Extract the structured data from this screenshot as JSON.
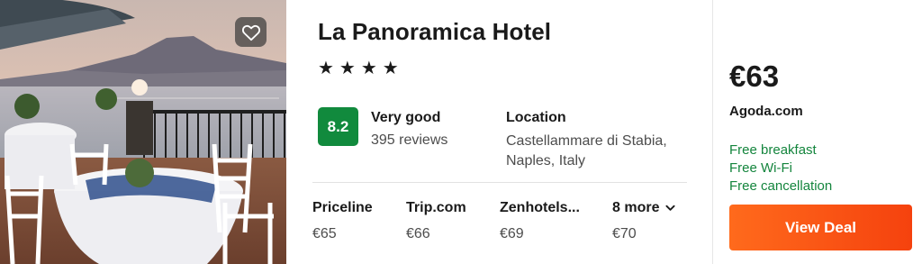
{
  "hotel": {
    "name": "La Panoramica Hotel",
    "stars_text": "★★★★",
    "star_count": 4,
    "favorite_icon": "heart-outline-icon"
  },
  "rating": {
    "score": "8.2",
    "label": "Very good",
    "reviews": "395 reviews",
    "badge_color": "#118a3d"
  },
  "location": {
    "label": "Location",
    "line1": "Castellammare di Stabia,",
    "line2": "Naples, Italy"
  },
  "providers": [
    {
      "name": "Priceline",
      "price": "€65"
    },
    {
      "name": "Trip.com",
      "price": "€66"
    },
    {
      "name": "Zenhotels...",
      "price": "€69"
    }
  ],
  "more": {
    "label": "8 more",
    "price": "€70",
    "icon": "chevron-down-icon"
  },
  "deal": {
    "price": "€63",
    "vendor": "Agoda.com",
    "perks": [
      "Free breakfast",
      "Free Wi-Fi",
      "Free cancellation"
    ],
    "perk_color": "#14853d",
    "button_label": "View Deal",
    "button_color": "#f5420e"
  }
}
